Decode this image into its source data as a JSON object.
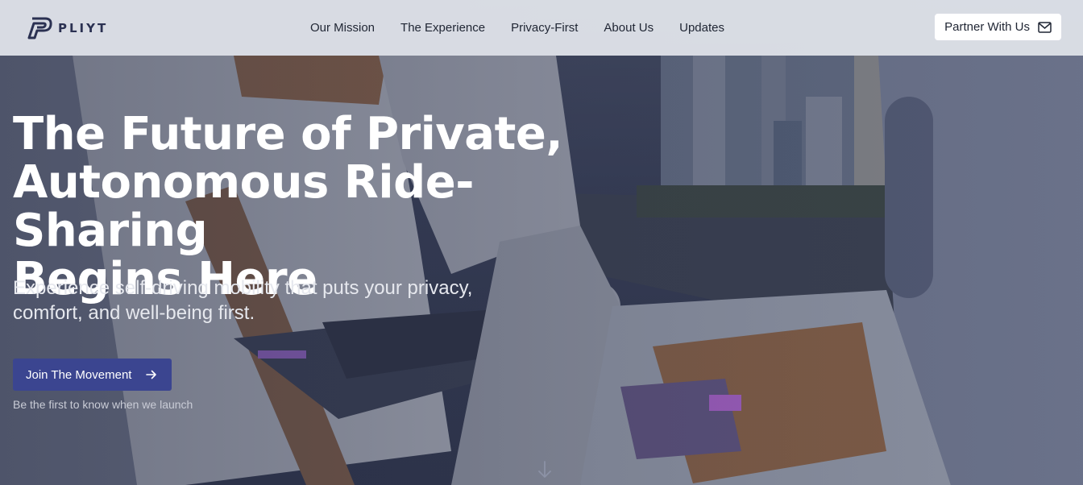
{
  "brand": {
    "name": "PLIYT"
  },
  "nav": {
    "items": [
      {
        "label": "Our Mission"
      },
      {
        "label": "The Experience"
      },
      {
        "label": "Privacy-First"
      },
      {
        "label": "About Us"
      },
      {
        "label": "Updates"
      }
    ]
  },
  "header": {
    "partner_label": "Partner With Us",
    "partner_icon": "mail-icon"
  },
  "hero": {
    "title_line1": "The Future of Private,",
    "title_line2": "Autonomous Ride-Sharing",
    "title_line3": "Begins Here",
    "subtitle_line1": "Experience self-driving mobility that puts your privacy,",
    "subtitle_line2": "comfort, and well-being first.",
    "cta_label": "Join The Movement",
    "cta_icon": "arrow-right-icon",
    "cta_note": "Be the first to know when we launch",
    "scroll_icon": "arrow-down-icon"
  },
  "colors": {
    "accent": "#3b4590",
    "brand": "#2b3152",
    "header_bg": "#e4e7ee"
  }
}
